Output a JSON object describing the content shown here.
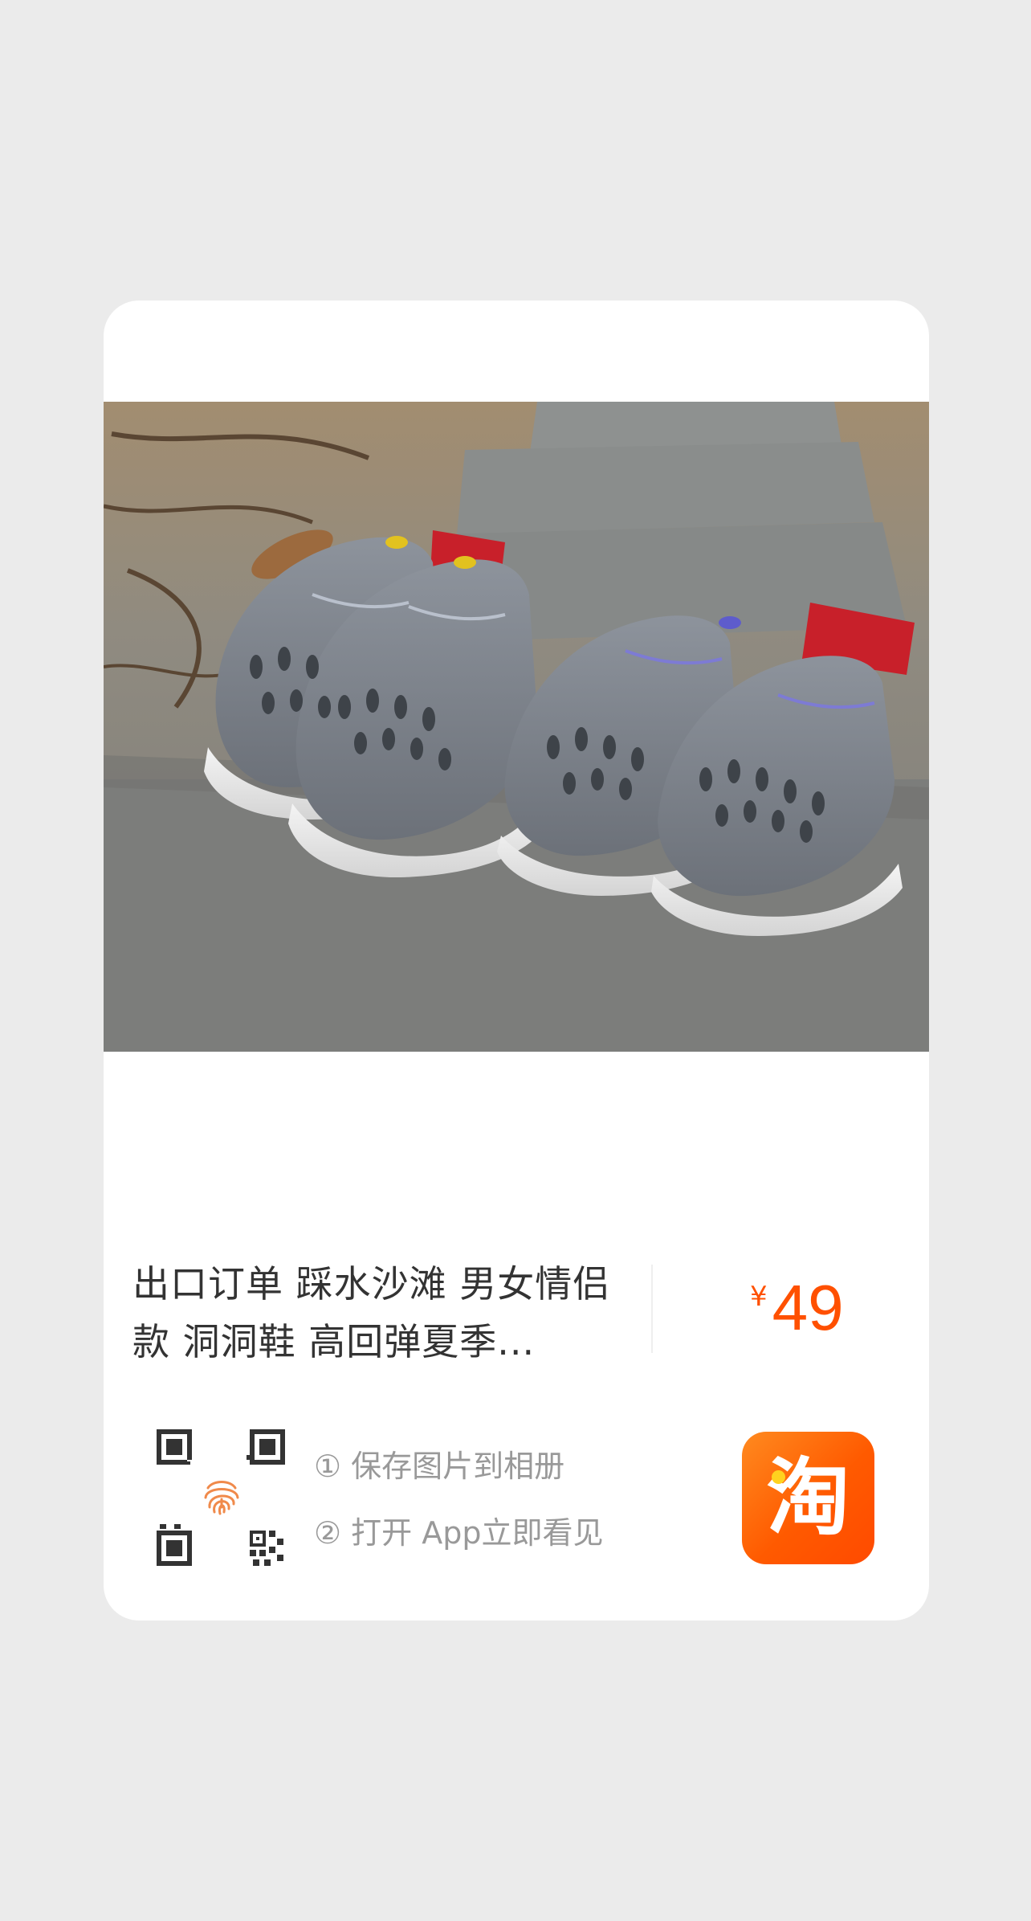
{
  "product": {
    "title": "出口订单 踩水沙滩  男女情侣款 洞洞鞋 高回弹夏季...",
    "price_symbol": "¥",
    "price": "49"
  },
  "instructions": {
    "step1": "① 保存图片到相册",
    "step2": "② 打开 App立即看见"
  },
  "logo": {
    "text": "淘"
  },
  "colors": {
    "accent": "#ff5000",
    "background": "#ebebeb",
    "card": "#ffffff"
  },
  "icons": [
    "qr-code-icon",
    "fingerprint-icon",
    "taobao-logo-icon"
  ]
}
